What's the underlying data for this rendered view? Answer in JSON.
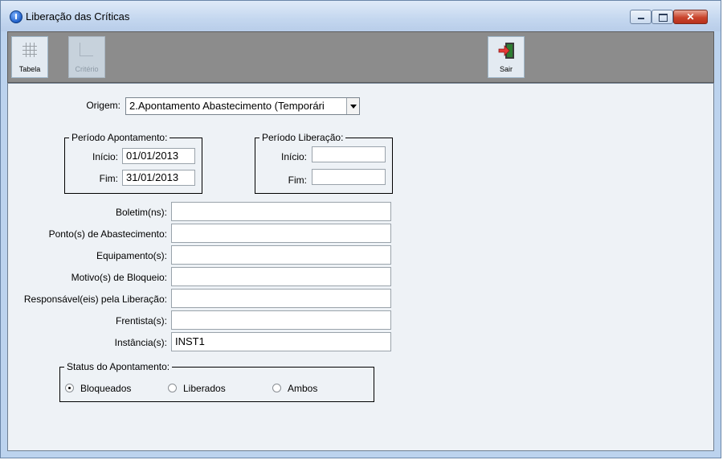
{
  "window": {
    "title": "Liberação das Críticas",
    "controls": {
      "minimize": "minimize",
      "maximize": "maximize",
      "close": "✕"
    }
  },
  "toolbar": {
    "tabelas_label": "Tabela",
    "criterio_label": "Critério",
    "sair_label": "Sair",
    "icons": {
      "tabelas": "grid-icon",
      "criterio": "criteria-icon",
      "sair": "exit-door-icon"
    }
  },
  "form": {
    "origem": {
      "label": "Origem:",
      "value": "2.Apontamento Abastecimento (Temporári"
    },
    "periodo_apontamento": {
      "legend": "Período Apontamento:",
      "inicio_label": "Início:",
      "inicio_value": "01/01/2013",
      "fim_label": "Fim:",
      "fim_value": "31/01/2013"
    },
    "periodo_liberacao": {
      "legend": "Período Liberação:",
      "inicio_label": "Início:",
      "inicio_value": "",
      "fim_label": "Fim:",
      "fim_value": ""
    },
    "fields": {
      "boletins_label": "Boletim(ns):",
      "boletins_value": "",
      "pontos_label": "Ponto(s) de Abastecimento:",
      "pontos_value": "",
      "equipamentos_label": "Equipamento(s):",
      "equipamentos_value": "",
      "motivos_label": "Motivo(s) de Bloqueio:",
      "motivos_value": "",
      "responsaveis_label": "Responsável(eis) pela Liberação:",
      "responsaveis_value": "",
      "frentistas_label": "Frentista(s):",
      "frentistas_value": "",
      "instancias_label": "Instância(s):",
      "instancias_value": "INST1"
    },
    "status": {
      "legend": "Status do Apontamento:",
      "options": [
        "Bloqueados",
        "Liberados",
        "Ambos"
      ],
      "selected": "Bloqueados"
    }
  }
}
